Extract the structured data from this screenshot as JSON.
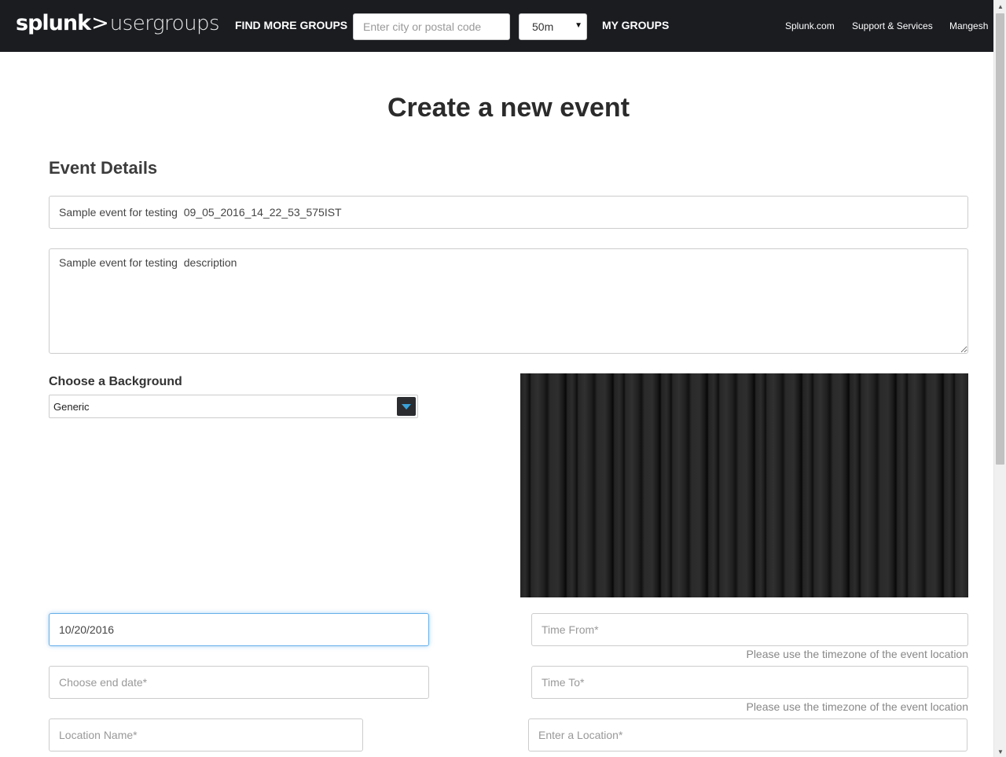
{
  "header": {
    "logo_main": "splunk",
    "logo_chevron": ">",
    "logo_sub": "usergroups",
    "find_groups": "FIND MORE GROUPS",
    "search_placeholder": "Enter city or postal code",
    "radius_value": "50m",
    "my_groups": "MY GROUPS",
    "right_links": {
      "splunk_com": "Splunk.com",
      "support": "Support & Services",
      "user": "Mangesh"
    }
  },
  "page": {
    "title": "Create a new event",
    "section_title": "Event Details"
  },
  "form": {
    "title_value": "Sample event for testing  09_05_2016_14_22_53_575IST",
    "description_value": "Sample event for testing  description",
    "background_label": "Choose a Background",
    "background_value": "Generic",
    "start_date_value": "10/20/2016",
    "end_date_placeholder": "Choose end date*",
    "time_from_placeholder": "Time From*",
    "time_to_placeholder": "Time To*",
    "timezone_note": "Please use the timezone of the event location",
    "location_name_placeholder": "Location Name*",
    "location_placeholder": "Enter a Location*"
  },
  "icons": {
    "dropdown": "caret-down-icon",
    "scroll_up": "scroll-up-icon",
    "scroll_down": "scroll-down-icon"
  },
  "colors": {
    "header_bg": "#1a1c20",
    "focus_border": "#66afe9",
    "select_caret": "#3aa1d8"
  }
}
